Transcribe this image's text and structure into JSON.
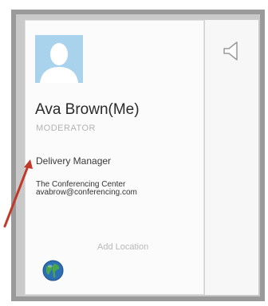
{
  "profile": {
    "name": "Ava Brown(Me)",
    "role": "MODERATOR",
    "job_title": "Delivery Manager",
    "company": "The Conferencing Center",
    "email": "avabrow@conferencing.com"
  },
  "location": {
    "add_label": "Add Location"
  },
  "icons": {
    "avatar": "user-silhouette",
    "globe": "globe-icon",
    "speaker": "speaker-icon"
  },
  "colors": {
    "avatar_bg": "#a9d3ec",
    "arrow": "#c0392b"
  }
}
